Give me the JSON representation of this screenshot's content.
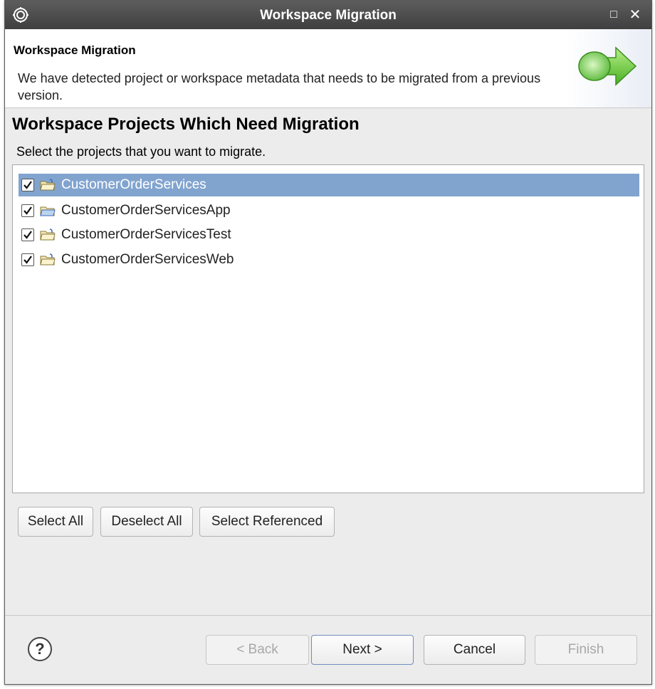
{
  "window": {
    "title": "Workspace Migration",
    "maximize_glyph": "□",
    "close_glyph": "✕"
  },
  "banner": {
    "title": "Workspace Migration",
    "message": "We have detected project or workspace metadata that needs to be migrated from a previous version."
  },
  "section": {
    "title": "Workspace Projects Which Need Migration",
    "description": "Select the projects that you want to migrate."
  },
  "projects": [
    {
      "label": "CustomerOrderServices",
      "checked": true,
      "selected": true
    },
    {
      "label": "CustomerOrderServicesApp",
      "checked": true,
      "selected": false
    },
    {
      "label": "CustomerOrderServicesTest",
      "checked": true,
      "selected": false
    },
    {
      "label": "CustomerOrderServicesWeb",
      "checked": true,
      "selected": false
    }
  ],
  "actions": {
    "select_all": "Select All",
    "deselect_all": "Deselect All",
    "select_referenced": "Select Referenced"
  },
  "footer": {
    "help_glyph": "?",
    "back": "< Back",
    "next": "Next >",
    "cancel": "Cancel",
    "finish": "Finish"
  },
  "colors": {
    "selection": "#81a4cf",
    "titlebar": "#4a4a4a"
  }
}
